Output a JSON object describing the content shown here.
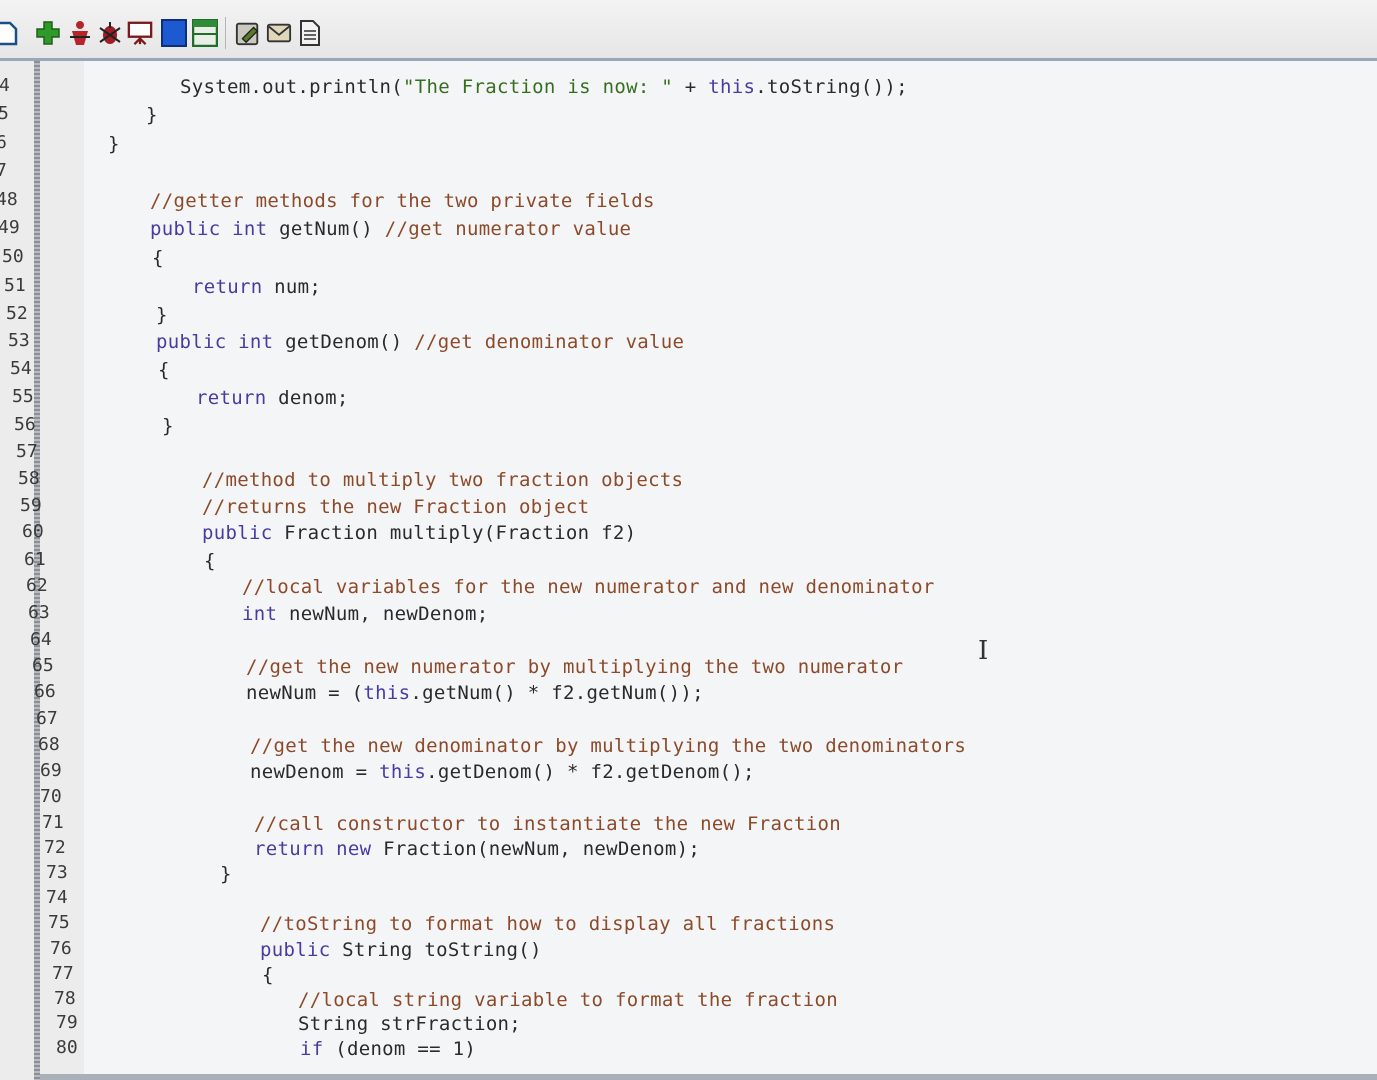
{
  "toolbar": {
    "icons": [
      "new-file-icon",
      "add-icon",
      "run-icon",
      "debug-icon",
      "presentation-icon",
      "blue-square-icon",
      "green-window-icon",
      "edit-icon",
      "mail-icon",
      "document-icon"
    ]
  },
  "editor": {
    "line_numbers": [
      "4",
      "5",
      "6",
      "7",
      "48",
      "49",
      "50",
      "51",
      "52",
      "53",
      "54",
      "55",
      "56",
      "57",
      "58",
      "59",
      "60",
      "61",
      "62",
      "63",
      "64",
      "65",
      "66",
      "67",
      "68",
      "69",
      "70",
      "71",
      "72",
      "73",
      "74",
      "75",
      "76",
      "77",
      "78",
      "79",
      "80"
    ],
    "lines": [
      {
        "segments": [
          {
            "text": "System.out.println(",
            "cls": ""
          },
          {
            "text": "\"The Fraction is now: \"",
            "cls": "str"
          },
          {
            "text": " + ",
            "cls": ""
          },
          {
            "text": "this",
            "cls": "kw"
          },
          {
            "text": ".toString());",
            "cls": ""
          }
        ]
      },
      {
        "segments": [
          {
            "text": "}",
            "cls": ""
          }
        ]
      },
      {
        "segments": [
          {
            "text": "}",
            "cls": ""
          }
        ]
      },
      {
        "segments": []
      },
      {
        "segments": [
          {
            "text": "//getter methods for the two private fields",
            "cls": "cm"
          }
        ]
      },
      {
        "segments": [
          {
            "text": "public int",
            "cls": "kw"
          },
          {
            "text": " getNum() ",
            "cls": ""
          },
          {
            "text": "//get numerator value",
            "cls": "cm"
          }
        ]
      },
      {
        "segments": [
          {
            "text": "{",
            "cls": ""
          }
        ]
      },
      {
        "segments": [
          {
            "text": "return",
            "cls": "kw"
          },
          {
            "text": " num;",
            "cls": ""
          }
        ]
      },
      {
        "segments": [
          {
            "text": "}",
            "cls": ""
          }
        ]
      },
      {
        "segments": [
          {
            "text": "public int",
            "cls": "kw"
          },
          {
            "text": " getDenom() ",
            "cls": ""
          },
          {
            "text": "//get denominator value",
            "cls": "cm"
          }
        ]
      },
      {
        "segments": [
          {
            "text": "{",
            "cls": ""
          }
        ]
      },
      {
        "segments": [
          {
            "text": "return",
            "cls": "kw"
          },
          {
            "text": " denom;",
            "cls": ""
          }
        ]
      },
      {
        "segments": [
          {
            "text": "}",
            "cls": ""
          }
        ]
      },
      {
        "segments": []
      },
      {
        "segments": [
          {
            "text": "//method to multiply two fraction objects",
            "cls": "cm"
          }
        ]
      },
      {
        "segments": [
          {
            "text": "//returns the new Fraction object",
            "cls": "cm"
          }
        ]
      },
      {
        "segments": [
          {
            "text": "public",
            "cls": "kw"
          },
          {
            "text": " Fraction multiply(Fraction f2)",
            "cls": ""
          }
        ]
      },
      {
        "segments": [
          {
            "text": "{",
            "cls": ""
          }
        ]
      },
      {
        "segments": [
          {
            "text": "//local variables for the new numerator and new denominator",
            "cls": "cm"
          }
        ]
      },
      {
        "segments": [
          {
            "text": "int",
            "cls": "kw"
          },
          {
            "text": " newNum, newDenom;",
            "cls": ""
          }
        ]
      },
      {
        "segments": []
      },
      {
        "segments": [
          {
            "text": "//get the new numerator by multiplying the two numerator",
            "cls": "cm"
          }
        ]
      },
      {
        "segments": [
          {
            "text": "newNum = (",
            "cls": ""
          },
          {
            "text": "this",
            "cls": "kw"
          },
          {
            "text": ".getNum() * f2.getNum());",
            "cls": ""
          }
        ]
      },
      {
        "segments": []
      },
      {
        "segments": [
          {
            "text": "//get the new denominator by multiplying the two denominators",
            "cls": "cm"
          }
        ]
      },
      {
        "segments": [
          {
            "text": "newDenom = ",
            "cls": ""
          },
          {
            "text": "this",
            "cls": "kw"
          },
          {
            "text": ".getDenom() * f2.getDenom();",
            "cls": ""
          }
        ]
      },
      {
        "segments": []
      },
      {
        "segments": [
          {
            "text": "//call constructor to instantiate the new Fraction",
            "cls": "cm"
          }
        ]
      },
      {
        "segments": [
          {
            "text": "return new",
            "cls": "kw"
          },
          {
            "text": " Fraction(newNum, newDenom);",
            "cls": ""
          }
        ]
      },
      {
        "segments": [
          {
            "text": "}",
            "cls": ""
          }
        ]
      },
      {
        "segments": []
      },
      {
        "segments": [
          {
            "text": "//toString to format how to display all fractions",
            "cls": "cm"
          }
        ]
      },
      {
        "segments": [
          {
            "text": "public",
            "cls": "kw"
          },
          {
            "text": " String toString()",
            "cls": ""
          }
        ]
      },
      {
        "segments": [
          {
            "text": "{",
            "cls": ""
          }
        ]
      },
      {
        "segments": [
          {
            "text": "//local string variable to format the fraction",
            "cls": "cm"
          }
        ]
      },
      {
        "segments": [
          {
            "text": "String strFraction;",
            "cls": ""
          }
        ]
      },
      {
        "segments": [
          {
            "text": "if",
            "cls": "kw"
          },
          {
            "text": " (denom == 1)",
            "cls": ""
          }
        ]
      }
    ]
  }
}
